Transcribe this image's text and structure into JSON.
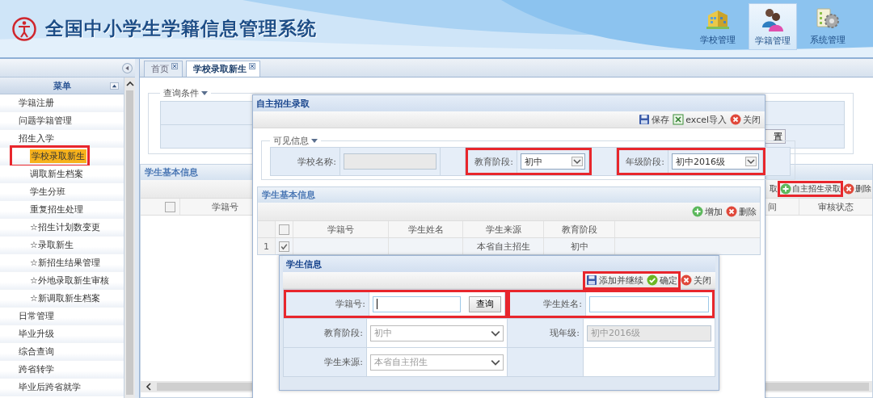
{
  "header": {
    "title": "全国中小学生学籍信息管理系统",
    "nav": [
      {
        "label": "学校管理",
        "kind": "building",
        "selected": false
      },
      {
        "label": "学籍管理",
        "kind": "people",
        "selected": true
      },
      {
        "label": "系统管理",
        "kind": "gear",
        "selected": false
      }
    ]
  },
  "sidebar": {
    "title": "菜单",
    "items": [
      {
        "label": "学籍注册",
        "selected": false
      },
      {
        "label": "问题学籍管理",
        "selected": false
      },
      {
        "label": "招生入学",
        "selected": false,
        "children": [
          {
            "label": "学校录取新生",
            "selected": true,
            "annotated": true
          },
          {
            "label": "调取新生档案",
            "selected": false
          },
          {
            "label": "学生分班",
            "selected": false
          },
          {
            "label": "重复招生处理",
            "selected": false
          },
          {
            "label": "☆招生计划数变更",
            "selected": false
          },
          {
            "label": "☆录取新生",
            "selected": false
          },
          {
            "label": "☆新招生结果管理",
            "selected": false
          },
          {
            "label": "☆外地录取新生审核",
            "selected": false
          },
          {
            "label": "☆新调取新生档案",
            "selected": false
          }
        ]
      },
      {
        "label": "日常管理",
        "selected": false
      },
      {
        "label": "毕业升级",
        "selected": false
      },
      {
        "label": "综合查询",
        "selected": false
      },
      {
        "label": "跨省转学",
        "selected": false
      },
      {
        "label": "毕业后跨省就学",
        "selected": false
      }
    ]
  },
  "tabs": [
    {
      "label": "首页",
      "selected": false
    },
    {
      "label": "学校录取新生",
      "selected": true
    }
  ],
  "page": {
    "query_legend": "查询条件",
    "query_button": "置",
    "panel_title": "学生基本信息",
    "toolbar": [
      {
        "label": "取",
        "kind": "text"
      },
      {
        "label": "自主招生录取",
        "kind": "add",
        "annotated": true
      },
      {
        "label": "删除",
        "kind": "delete"
      }
    ],
    "header_checked": false,
    "columns": [
      "学籍号",
      "间",
      "审核状态"
    ]
  },
  "dialog": {
    "title": "自主招生录取",
    "toolbar": [
      {
        "label": "保存",
        "kind": "save"
      },
      {
        "label": "excel导入",
        "kind": "excel"
      },
      {
        "label": "关闭",
        "kind": "close"
      }
    ],
    "legend": "可见信息",
    "fields": [
      {
        "label": "学校名称:",
        "kind": "input",
        "disabled": true
      },
      {
        "label": "教育阶段:",
        "kind": "select",
        "value": "初中",
        "disabled": false,
        "annotated": true
      },
      {
        "label": "年级阶段:",
        "kind": "select",
        "value": "初中2016级",
        "disabled": false,
        "annotated": true
      }
    ],
    "panel_title": "学生基本信息",
    "panel_toolbar": [
      {
        "label": "增加",
        "kind": "add"
      },
      {
        "label": "删除",
        "kind": "delete"
      }
    ],
    "header_checked": false,
    "columns": [
      "学籍号",
      "学生姓名",
      "学生来源",
      "教育阶段"
    ],
    "rows": [
      {
        "number": "1",
        "checked": true,
        "source": "本省自主招生",
        "stage": "初中"
      }
    ]
  },
  "subdialog": {
    "title": "学生信息",
    "toolbar": [
      {
        "label": "添加并继续",
        "kind": "save",
        "annotated": true
      },
      {
        "label": "确定",
        "kind": "ok",
        "annotated": true
      },
      {
        "label": "关闭",
        "kind": "close"
      }
    ],
    "rows": [
      [
        {
          "label": "学籍号:",
          "kind": "input",
          "focused": true,
          "button": "查询",
          "disabled": false,
          "annotated": true
        },
        {
          "label": "学生姓名:",
          "kind": "input",
          "disabled": false,
          "annotated": true
        }
      ],
      [
        {
          "label": "教育阶段:",
          "kind": "select",
          "value": "初中",
          "disabled": true
        },
        {
          "label": "现年级:",
          "kind": "input",
          "value": "初中2016级",
          "disabled": true
        }
      ],
      [
        {
          "label": "学生来源:",
          "kind": "select",
          "value": "本省自主招生",
          "disabled": true
        },
        {
          "kind": "empty"
        }
      ]
    ]
  }
}
